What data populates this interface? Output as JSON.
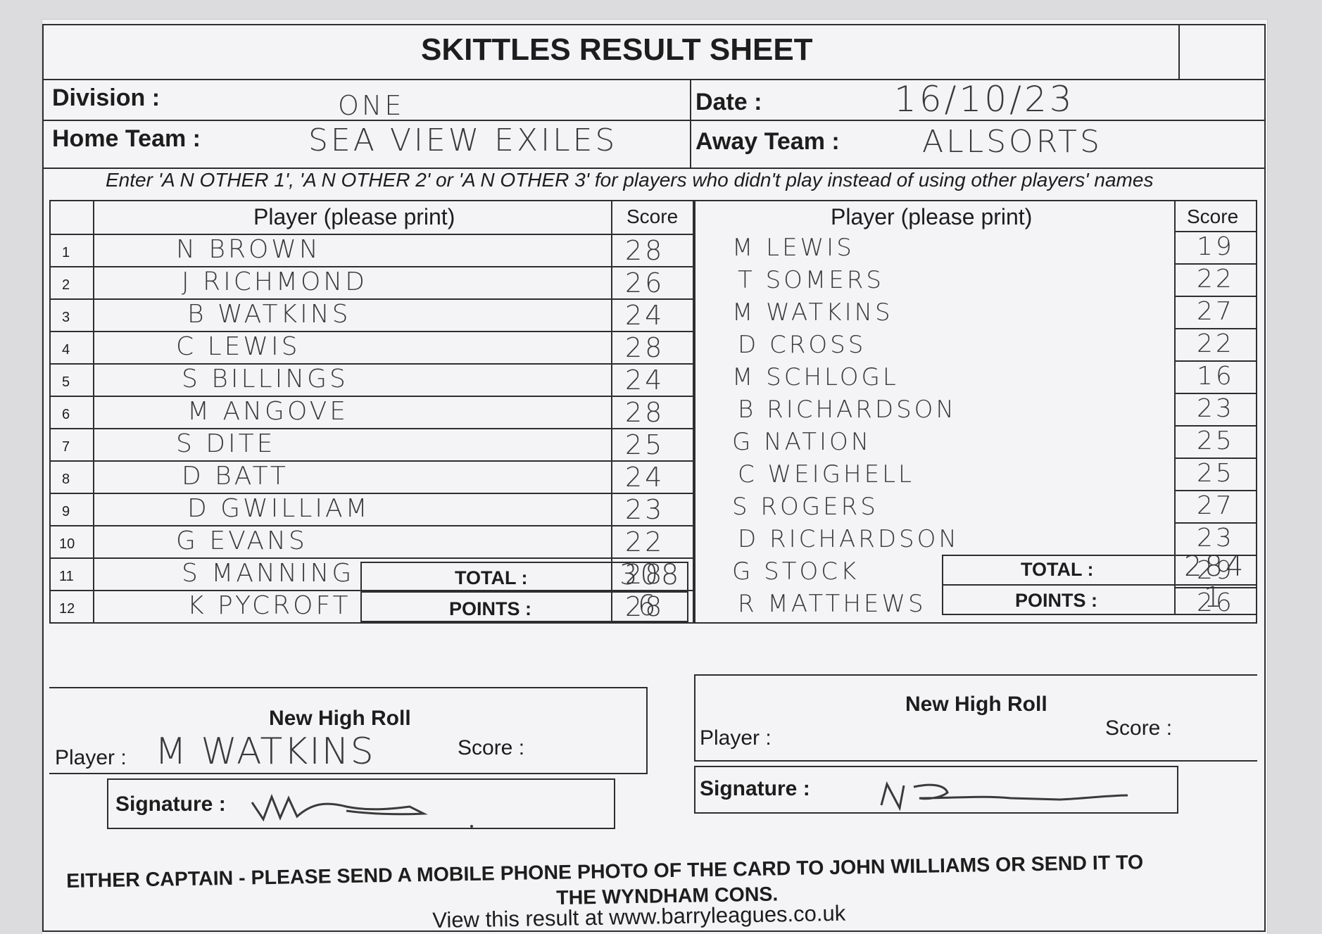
{
  "title": "SKITTLES RESULT SHEET",
  "division": {
    "label": "Division :",
    "value": "ONE"
  },
  "date": {
    "label": "Date :",
    "value": "16/10/23"
  },
  "home_team": {
    "label": "Home Team :",
    "value": "SEA VIEW EXILES"
  },
  "away_team": {
    "label": "Away Team :",
    "value": "ALLSORTS"
  },
  "instruction": "Enter 'A N OTHER 1', 'A N OTHER 2' or 'A N OTHER 3' for players who didn't play instead of using other players' names",
  "columns": {
    "player": "Player (please print)",
    "score": "Score"
  },
  "home_players": [
    {
      "num": "1",
      "name": "N BROWN",
      "score": "28"
    },
    {
      "num": "2",
      "name": "J RICHMOND",
      "score": "26"
    },
    {
      "num": "3",
      "name": "B WATKINS",
      "score": "24"
    },
    {
      "num": "4",
      "name": "C LEWIS",
      "score": "28"
    },
    {
      "num": "5",
      "name": "S BILLINGS",
      "score": "24"
    },
    {
      "num": "6",
      "name": "M ANGOVE",
      "score": "28"
    },
    {
      "num": "7",
      "name": "S DITE",
      "score": "25"
    },
    {
      "num": "8",
      "name": "D BATT",
      "score": "24"
    },
    {
      "num": "9",
      "name": "D GWILLIAM",
      "score": "23"
    },
    {
      "num": "10",
      "name": "G EVANS",
      "score": "22"
    },
    {
      "num": "11",
      "name": "S MANNING",
      "score": "28"
    },
    {
      "num": "12",
      "name": "K PYCROFT",
      "score": "28"
    }
  ],
  "away_players": [
    {
      "name": "M LEWIS",
      "score": "19"
    },
    {
      "name": "T SOMERS",
      "score": "22"
    },
    {
      "name": "M WATKINS",
      "score": "27"
    },
    {
      "name": "D CROSS",
      "score": "22"
    },
    {
      "name": "M SCHLOGL",
      "score": "16"
    },
    {
      "name": "B RICHARDSON",
      "score": "23"
    },
    {
      "name": "G NATION",
      "score": "25"
    },
    {
      "name": "C WEIGHELL",
      "score": "25"
    },
    {
      "name": "S ROGERS",
      "score": "27"
    },
    {
      "name": "D RICHARDSON",
      "score": "23"
    },
    {
      "name": "G STOCK",
      "score": "29"
    },
    {
      "name": "R MATTHEWS",
      "score": "26"
    }
  ],
  "home_totals": {
    "total_label": "TOTAL :",
    "total": "308",
    "points_label": "POINTS :",
    "points": "6"
  },
  "away_totals": {
    "total_label": "TOTAL :",
    "total": "284",
    "points_label": "POINTS :",
    "points": "1"
  },
  "home_high_roll": {
    "heading": "New High Roll",
    "player_label": "Player :",
    "player": "M WATKINS",
    "score_label": "Score :",
    "signature_label": "Signature :"
  },
  "away_high_roll": {
    "heading": "New High Roll",
    "player_label": "Player :",
    "score_label": "Score :",
    "signature_label": "Signature :"
  },
  "footer": {
    "line1": "EITHER CAPTAIN - PLEASE SEND A MOBILE PHONE PHOTO OF THE CARD TO JOHN WILLIAMS OR SEND IT TO",
    "line2": "THE WYNDHAM CONS.",
    "line3": "View this result at www.barryleagues.co.uk"
  }
}
